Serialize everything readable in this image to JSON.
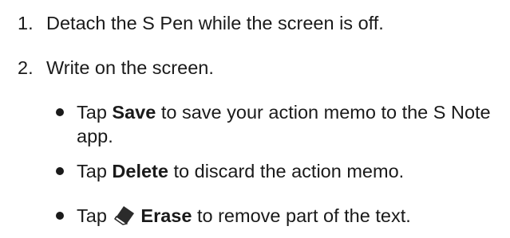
{
  "steps": [
    {
      "number": "1.",
      "text": "Detach the S Pen while the screen is off."
    },
    {
      "number": "2.",
      "text": "Write on the screen."
    }
  ],
  "bullets": {
    "save": {
      "pre": "Tap ",
      "label": "Save",
      "post": " to save your action memo to the S Note app."
    },
    "delete": {
      "pre": "Tap ",
      "label": "Delete",
      "post": " to discard the action memo."
    },
    "erase": {
      "pre": "Tap ",
      "icon": "eraser-icon",
      "label": "Erase",
      "post": " to remove part of the text."
    }
  }
}
